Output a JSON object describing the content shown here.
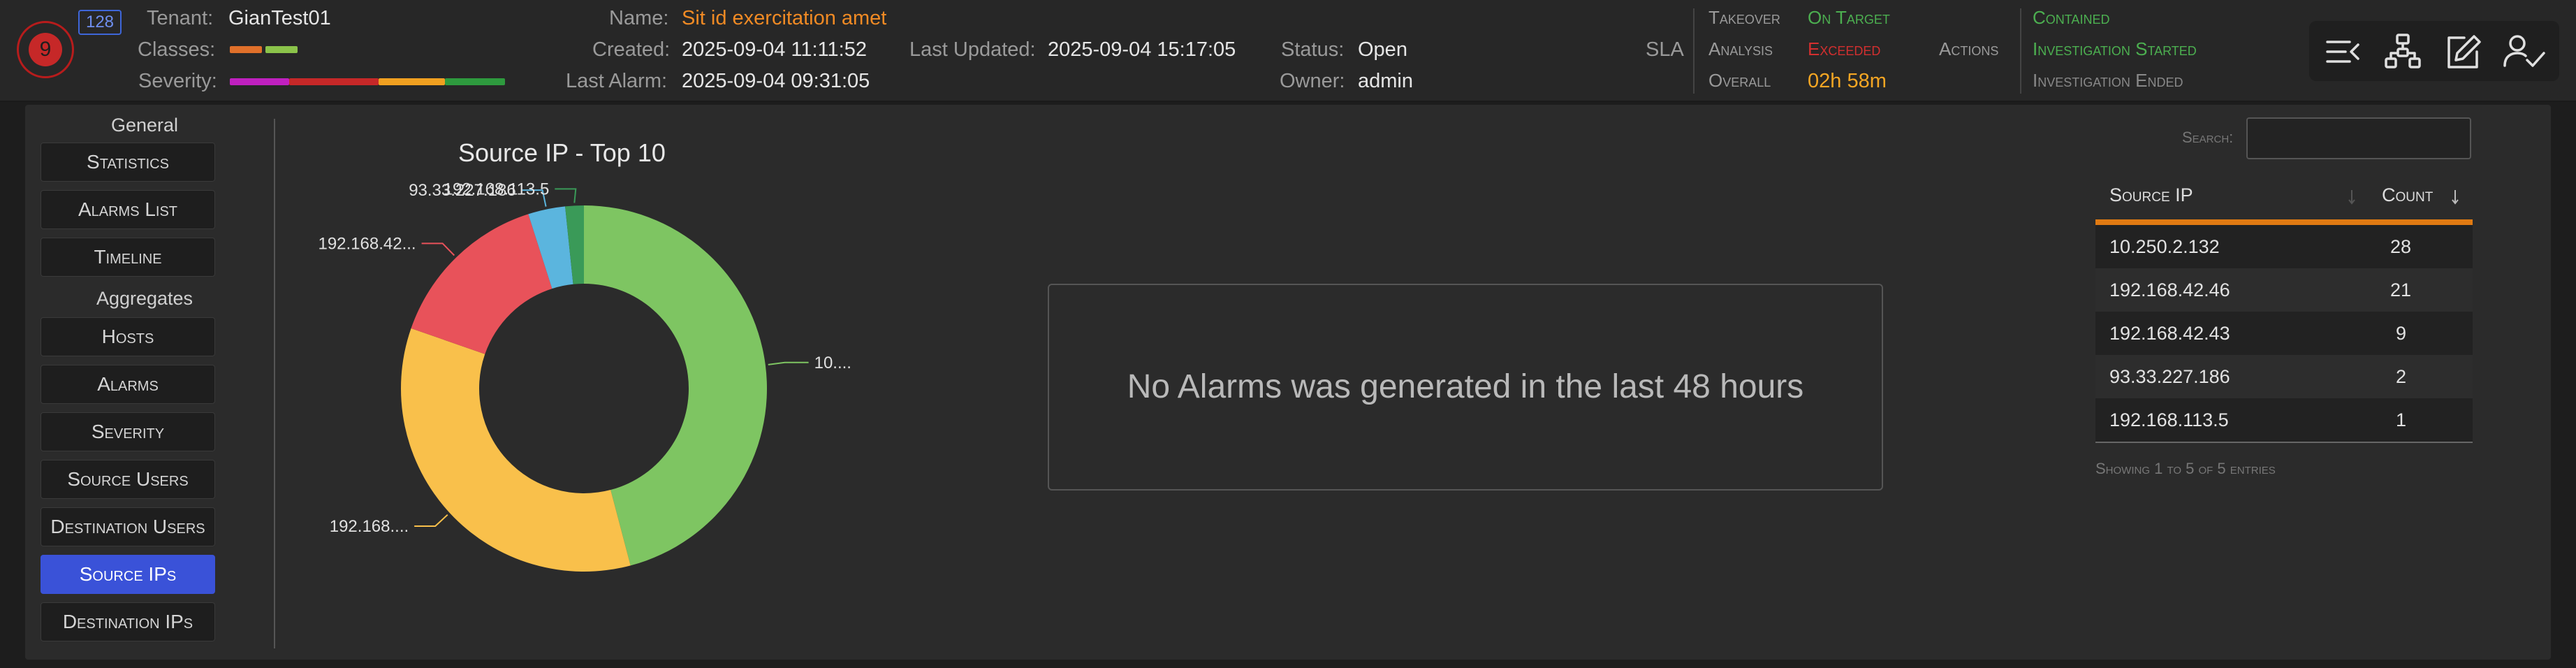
{
  "header": {
    "badge_count": "128",
    "badge_level": "9",
    "tenant_label": "Tenant:",
    "tenant": "GianTest01",
    "classes_label": "Classes:",
    "severity_label": "Severity:",
    "name_label": "Name:",
    "name": "Sit id exercitation amet",
    "created_label": "Created:",
    "created": "2025-09-04 11:11:52",
    "last_updated_label": "Last Updated:",
    "last_updated": "2025-09-04 15:17:05",
    "last_alarm_label": "Last Alarm:",
    "last_alarm": "2025-09-04 09:31:05",
    "status_label": "Status:",
    "status": "Open",
    "owner_label": "Owner:",
    "owner": "admin",
    "sla_label": "SLA",
    "takeover_label": "Takeover",
    "takeover_value": "On Target",
    "analysis_label": "Analysis",
    "analysis_value": "Exceeded",
    "overall_label": "Overall",
    "overall_value": "02h 58m",
    "actions_label": "Actions",
    "action_contained": "Contained",
    "action_investigation_started": "Investigation Started",
    "action_investigation_ended": "Investigation Ended",
    "colors": {
      "green": "#4caf50",
      "red": "#e53935",
      "orange": "#ff9800",
      "grey": "#777777"
    }
  },
  "toolbar": {
    "icons": [
      "collapse-menu-icon",
      "hierarchy-icon",
      "edit-icon",
      "assign-user-icon"
    ]
  },
  "nav": {
    "general_heading": "General",
    "aggregates_heading": "Aggregates",
    "general_items": [
      "Statistics",
      "Alarms List",
      "Timeline"
    ],
    "aggregate_items": [
      "Hosts",
      "Alarms",
      "Severity",
      "Source Users",
      "Destination Users",
      "Source IPs",
      "Destination IPs"
    ],
    "active_item": "Source IPs"
  },
  "chart_data": {
    "type": "pie",
    "title": "Source IP - Top 10",
    "donut": true,
    "labels": [
      "10.250.2.132",
      "192.168.42.46",
      "192.168.42.43",
      "93.33.227.186",
      "192.168.113.5"
    ],
    "values": [
      28,
      21,
      9,
      2,
      1
    ],
    "colors": [
      "#7ec562",
      "#f9c04b",
      "#e8525a",
      "#5bb5de",
      "#3a9a58"
    ],
    "display_labels": [
      "10....",
      "192.168....",
      "192.168.42...",
      "93.33.227.186",
      "192.168.113.5"
    ]
  },
  "placeholder": {
    "message": "No Alarms was generated in the last 48 hours"
  },
  "table": {
    "search_label": "Search:",
    "search_value": "",
    "columns": [
      "Source IP",
      "Count"
    ],
    "rows": [
      [
        "10.250.2.132",
        "28"
      ],
      [
        "192.168.42.46",
        "21"
      ],
      [
        "192.168.42.43",
        "9"
      ],
      [
        "93.33.227.186",
        "2"
      ],
      [
        "192.168.113.5",
        "1"
      ]
    ],
    "footer": "Showing 1 to 5 of 5 entries"
  }
}
